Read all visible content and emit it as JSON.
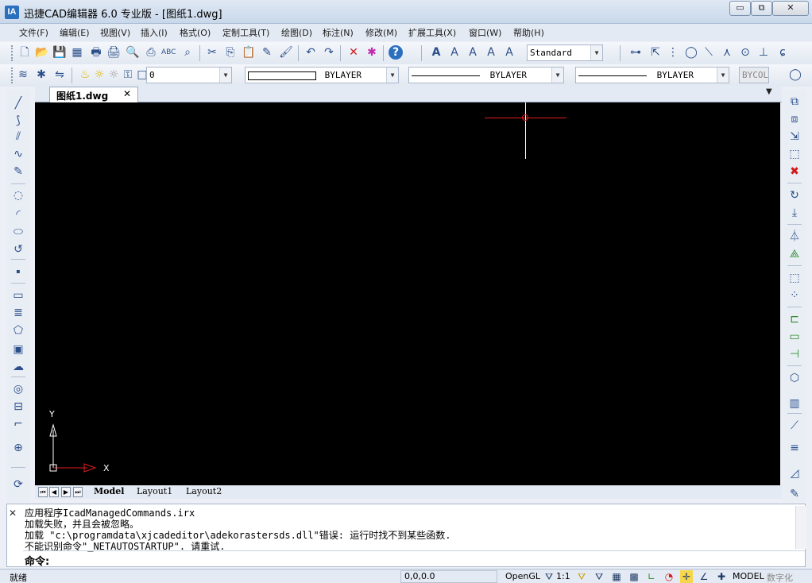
{
  "window": {
    "icon_letter": "IA",
    "title": "迅捷CAD编辑器 6.0 专业版  - [图纸1.dwg]",
    "minimize": "▭",
    "restore": "⧉",
    "close": "✕"
  },
  "menu": [
    {
      "label": "文件(F)"
    },
    {
      "label": "编辑(E)"
    },
    {
      "label": "视图(V)"
    },
    {
      "label": "插入(I)"
    },
    {
      "label": "格式(O)"
    },
    {
      "label": "定制工具(T)"
    },
    {
      "label": "绘图(D)"
    },
    {
      "label": "标注(N)"
    },
    {
      "label": "修改(M)"
    },
    {
      "label": "扩展工具(X)"
    },
    {
      "label": "窗口(W)"
    },
    {
      "label": "帮助(H)"
    }
  ],
  "toolbar1": {
    "text_style_value": "Standard",
    "icons": {
      "new": "🗋",
      "open": "📂",
      "save": "💾",
      "saveall": "▦",
      "plot": "🖶",
      "print": "🖨",
      "preview": "🔍",
      "publish": "⎙",
      "spellcheck": "ABC",
      "find": "⌕",
      "cut": "✂",
      "copy": "⎘",
      "paste": "📋",
      "matchprop": "✎",
      "brush": "🖌",
      "undo": "↶",
      "redo": "↷",
      "erase": "✕",
      "audit": "✱",
      "help": "?",
      "text_a": "A",
      "text_a2": "A",
      "text_a3": "A",
      "text_a4": "A",
      "text_a5": "A"
    }
  },
  "toolbar2": {
    "layer_value": "0",
    "color_value": "BYLAYER",
    "linetype_value": "BYLAYER",
    "lineweight_value": "BYLAYER",
    "plotstyle_value": "BYCOL"
  },
  "document": {
    "tab_label": "图纸1.dwg",
    "tab_close": "✕",
    "tabs_dropdown": "▼"
  },
  "canvas": {
    "background": "#000000",
    "ucs_x": "X",
    "ucs_y": "Y"
  },
  "layout_tabs": [
    {
      "label": "Model"
    },
    {
      "label": "Layout1"
    },
    {
      "label": "Layout2"
    }
  ],
  "command": {
    "close": "✕",
    "history": [
      "应用程序IcadManagedCommands.irx",
      "加载失败，并且会被忽略。",
      "加载 \"c:\\programdata\\xjcadeditor\\adekorastersds.dll\"错误: 运行时找不到某些函数.",
      "不能识别命令\"_NETAUTOSTARTUP\". 请重试."
    ],
    "prompt": "命令:"
  },
  "status": {
    "ready": "就绪",
    "coords": "0,0,0.0",
    "opengl": "OpenGL",
    "scale": "1:1",
    "model": "MODEL",
    "numeric": "数字化"
  },
  "colors": {
    "title_bg": "#c9d8ea",
    "accent": "#2b6fbf",
    "crosshair": "#e01c1c"
  }
}
